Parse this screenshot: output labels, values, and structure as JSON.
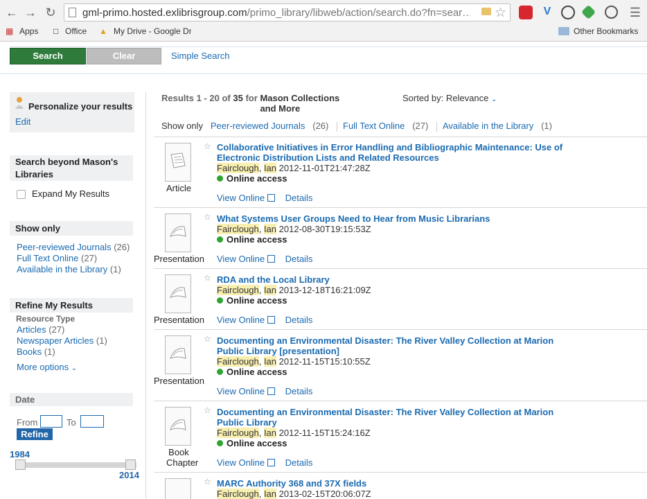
{
  "browser": {
    "url_main": "gml-primo.hosted.exlibrisgroup.com",
    "url_rest": "/primo_library/libweb/action/search.do?fn=sear…",
    "bookmarks": [
      "Apps",
      "Office",
      "My Drive - Google Dr",
      "Other Bookmarks"
    ]
  },
  "searchbar": {
    "search_label": "Search",
    "clear_label": "Clear",
    "simple_search": "Simple Search"
  },
  "sidebar": {
    "personalize": "Personalize your results",
    "edit": "Edit",
    "beyond_title": "Search beyond Mason's Libraries",
    "expand": "Expand My Results",
    "showonly_title": "Show only",
    "showonly_items": [
      {
        "label": "Peer-reviewed Journals",
        "count": "(26)"
      },
      {
        "label": "Full Text Online",
        "count": "(27)"
      },
      {
        "label": "Available in the Library",
        "count": "(1)"
      }
    ],
    "refine_title": "Refine My Results",
    "resource_type": "Resource Type",
    "resource_items": [
      {
        "label": "Articles",
        "count": "(27)"
      },
      {
        "label": "Newspaper Articles",
        "count": "(1)"
      },
      {
        "label": "Books",
        "count": "(1)"
      }
    ],
    "more_options": "More options",
    "date_title": "Date",
    "from": "From",
    "to": "To",
    "refine_btn": "Refine",
    "date_min": "1984",
    "date_max": "2014"
  },
  "results_meta": {
    "prefix": "Results",
    "range": "1 - 20",
    "of": "of",
    "total": "35",
    "for": "for",
    "scope": "Mason Collections and More",
    "sorted_label": "Sorted by:",
    "sorted_value": "Relevance",
    "show_only": "Show only",
    "facets": [
      {
        "label": "Peer-reviewed Journals",
        "count": "(26)"
      },
      {
        "label": "Full Text Online",
        "count": "(27)"
      },
      {
        "label": "Available in the Library",
        "count": "(1)"
      }
    ]
  },
  "results": [
    {
      "type": "Article",
      "title": "Collaborative Initiatives in Error Handling and Bibliographic Maintenance: Use of Electronic Distribution Lists and Related Resources",
      "author_last": "Fairclough",
      "author_first": "Ian",
      "date": "2012-11-01T21:47:28Z",
      "access": "Online access",
      "view": "View Online",
      "details": "Details"
    },
    {
      "type": "Presentation",
      "title": "What Systems User Groups Need to Hear from Music Librarians",
      "author_last": "Fairclough",
      "author_first": "Ian",
      "date": "2012-08-30T19:15:53Z",
      "access": "Online access",
      "view": "View Online",
      "details": "Details"
    },
    {
      "type": "Presentation",
      "title": "RDA and the Local Library",
      "author_last": "Fairclough",
      "author_first": "Ian",
      "date": "2013-12-18T16:21:09Z",
      "access": "Online access",
      "view": "View Online",
      "details": "Details"
    },
    {
      "type": "Presentation",
      "title": "Documenting an Environmental Disaster: The River Valley Collection at Marion Public Library [presentation]",
      "author_last": "Fairclough",
      "author_first": "Ian",
      "date": "2012-11-15T15:10:55Z",
      "access": "Online access",
      "view": "View Online",
      "details": "Details"
    },
    {
      "type": "Book Chapter",
      "title": "Documenting an Environmental Disaster: The River Valley Collection at Marion Public Library",
      "author_last": "Fairclough",
      "author_first": "Ian",
      "date": "2012-11-15T15:24:16Z",
      "access": "Online access",
      "view": "View Online",
      "details": "Details"
    },
    {
      "type": "",
      "title": "MARC Authority 368 and 37X fields",
      "author_last": "Fairclough",
      "author_first": "Ian",
      "date": "2013-02-15T20:06:07Z",
      "access": "",
      "view": "",
      "details": ""
    }
  ]
}
